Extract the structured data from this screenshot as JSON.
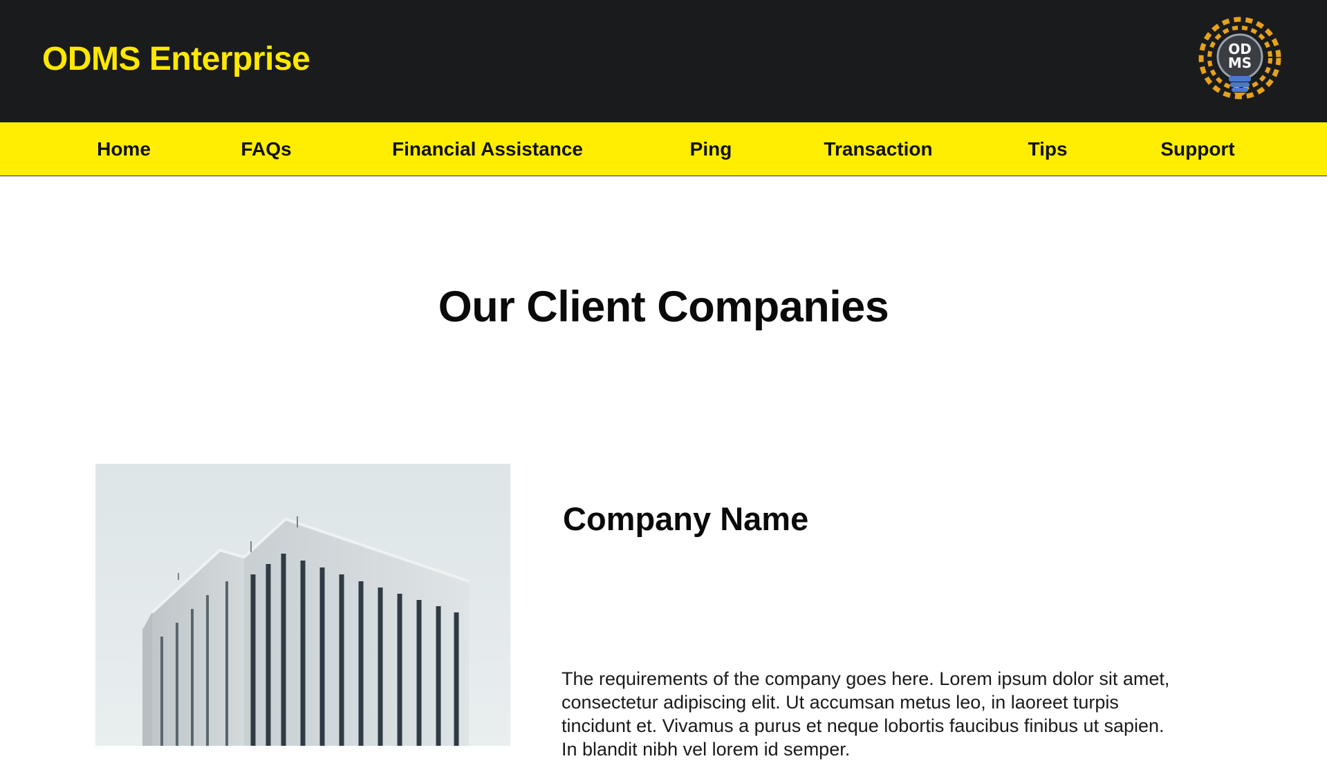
{
  "header": {
    "brand": "ODMS Enterprise",
    "logo": {
      "icon": "lightbulb-logo-icon",
      "text_line1": "OD",
      "text_line2": "MS"
    }
  },
  "nav": {
    "items": [
      {
        "label": "Home"
      },
      {
        "label": "FAQs"
      },
      {
        "label": "Financial Assistance"
      },
      {
        "label": "Ping"
      },
      {
        "label": "Transaction"
      },
      {
        "label": "Tips"
      },
      {
        "label": "Support"
      }
    ]
  },
  "main": {
    "title": "Our Client Companies",
    "company": {
      "name": "Company Name",
      "description": "The requirements of the company goes here. Lorem ipsum dolor sit amet, consectetur adipiscing elit. Ut accumsan metus leo, in laoreet turpis tincidunt et. Vivamus a purus et neque lobortis faucibus finibus ut sapien. In blandit nibh vel lorem id semper.",
      "image": "office-building-photo"
    }
  },
  "colors": {
    "header_bg": "#1a1b1d",
    "accent_yellow": "#ffee00",
    "brand_text": "#ffe800",
    "logo_orange": "#e6a21c",
    "logo_blue": "#4a79c9"
  }
}
